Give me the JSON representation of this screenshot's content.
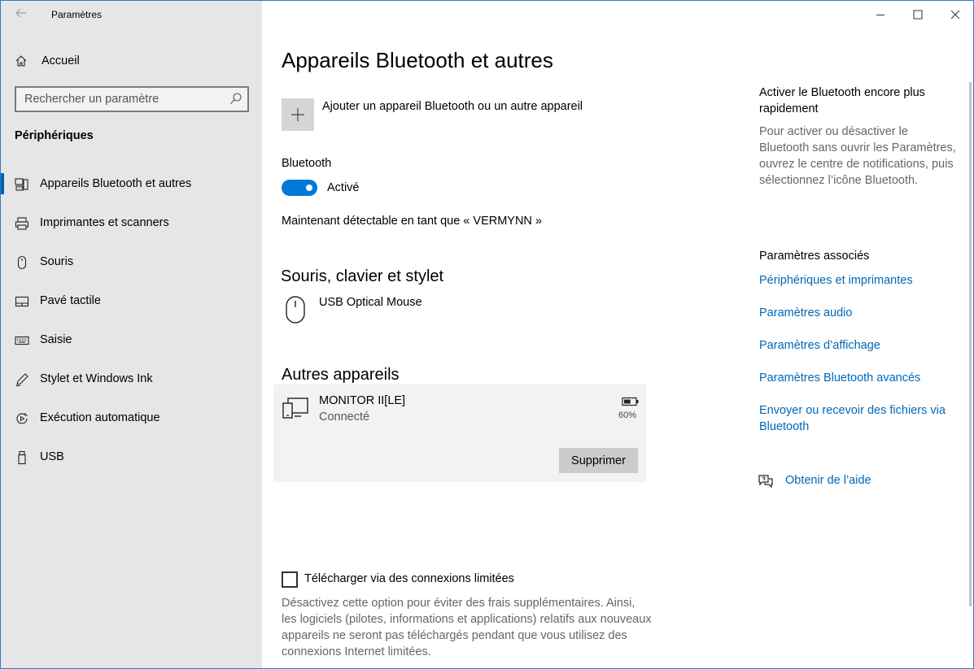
{
  "window": {
    "title": "Paramètres"
  },
  "sidebar": {
    "home_label": "Accueil",
    "search_placeholder": "Rechercher un paramètre",
    "section_label": "Périphériques",
    "items": [
      {
        "label": "Appareils Bluetooth et autres",
        "icon": "bluetooth-devices-icon",
        "active": true
      },
      {
        "label": "Imprimantes et scanners",
        "icon": "printer-icon"
      },
      {
        "label": "Souris",
        "icon": "mouse-icon"
      },
      {
        "label": "Pavé tactile",
        "icon": "touchpad-icon"
      },
      {
        "label": "Saisie",
        "icon": "keyboard-icon"
      },
      {
        "label": "Stylet et Windows Ink",
        "icon": "pen-icon"
      },
      {
        "label": "Exécution automatique",
        "icon": "autoplay-icon"
      },
      {
        "label": "USB",
        "icon": "usb-icon"
      }
    ]
  },
  "main": {
    "title": "Appareils Bluetooth et autres",
    "add_device_label": "Ajouter un appareil Bluetooth ou un autre appareil",
    "bluetooth_label": "Bluetooth",
    "bluetooth_state": "Activé",
    "bluetooth_on": true,
    "discoverable_text": "Maintenant détectable en tant que « VERMYNN »",
    "mouse_section": {
      "title": "Souris, clavier et stylet",
      "devices": [
        {
          "name": "USB Optical Mouse",
          "icon": "mouse-icon"
        }
      ]
    },
    "other_section": {
      "title": "Autres appareils",
      "devices": [
        {
          "name": "MONITOR II[LE]",
          "status": "Connecté",
          "battery": "60%",
          "battery_fraction": 0.6,
          "remove_label": "Supprimer",
          "icon": "device-icon"
        }
      ]
    },
    "metered": {
      "label": "Télécharger via des connexions limitées",
      "checked": false,
      "description": "Désactivez cette option pour éviter des frais supplémentaires. Ainsi, les logiciels (pilotes, informations et applications) relatifs aux nouveaux appareils ne seront pas téléchargés pendant que vous utilisez des connexions Internet limitées."
    }
  },
  "right": {
    "tip_title": "Activer le Bluetooth encore plus rapidement",
    "tip_text": "Pour activer ou désactiver le Bluetooth sans ouvrir les Paramètres, ouvrez le centre de notifications, puis sélectionnez l’icône Bluetooth.",
    "related_title": "Paramètres associés",
    "related_links": [
      "Périphériques et imprimantes",
      "Paramètres audio",
      "Paramètres d’affichage",
      "Paramètres Bluetooth avancés",
      "Envoyer ou recevoir des fichiers via Bluetooth"
    ],
    "help_label": "Obtenir de l’aide"
  },
  "colors": {
    "accent": "#0078d7",
    "link": "#0067b8",
    "sidebar_bg": "#e6e6e6",
    "card_bg": "#f2f2f2"
  }
}
